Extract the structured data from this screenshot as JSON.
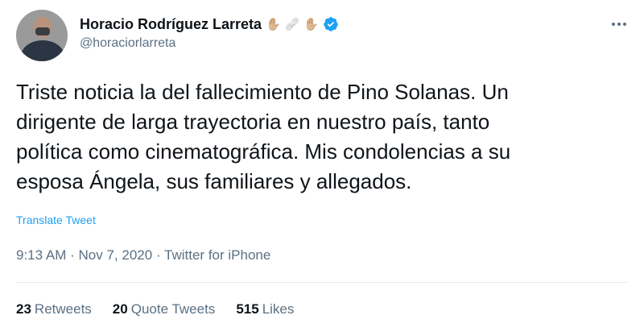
{
  "author": {
    "display_name": "Horacio Rodríguez Larreta",
    "emojis": [
      "✋🏼",
      "🩹",
      "✋🏼"
    ],
    "handle": "@horaciorlarreta",
    "verified_icon": "verified-badge-icon"
  },
  "tweet": {
    "text": "Triste noticia la del fallecimiento de Pino Solanas. Un\ndirigente de larga trayectoria en nuestro país, tanto\npolítica como cinematográfica. Mis condolencias a su\nesposa Ángela, sus familiares y allegados.",
    "translate_label": "Translate Tweet",
    "time": "9:13 AM",
    "date": "Nov 7, 2020",
    "source": "Twitter for iPhone",
    "separator": "·"
  },
  "stats": {
    "retweets_count": "23",
    "retweets_label": "Retweets",
    "quote_count": "20",
    "quote_label": "Quote Tweets",
    "likes_count": "515",
    "likes_label": "Likes"
  },
  "colors": {
    "accent": "#1da1f2",
    "secondary_text": "#5b7083",
    "primary_text": "#0f1419",
    "divider": "#e6ecf0"
  }
}
